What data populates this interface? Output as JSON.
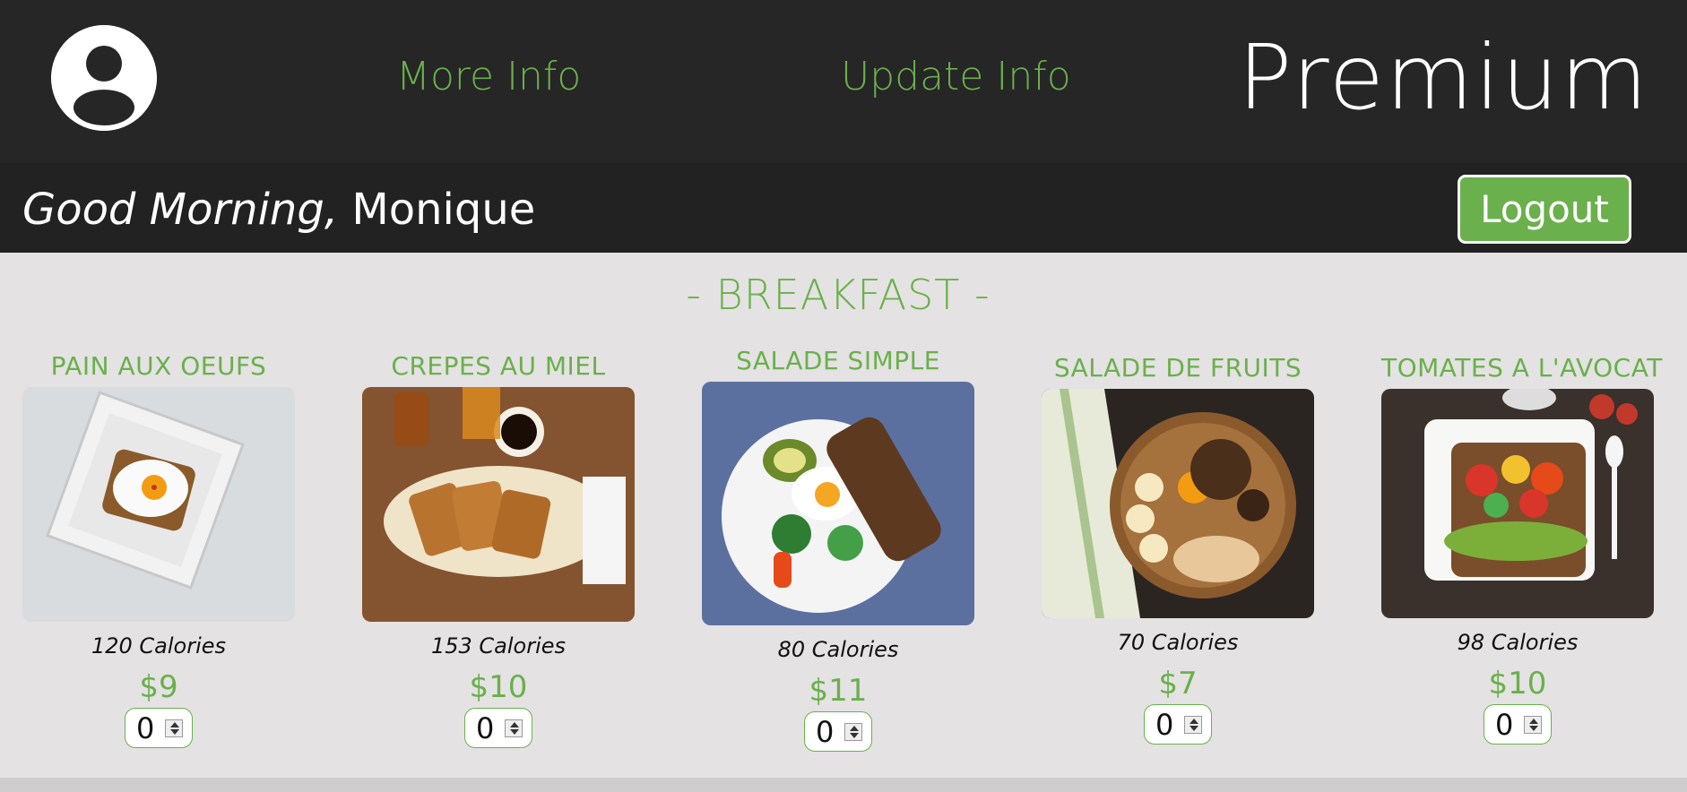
{
  "header": {
    "nav": {
      "more_info": "More Info",
      "update_info": "Update Info"
    },
    "brand": "Premium",
    "avatar_icon": "user-circle-icon"
  },
  "greeting": {
    "hello": "Good Morning,",
    "name": "Monique"
  },
  "logout_label": "Logout",
  "section": {
    "title": "- BREAKFAST -"
  },
  "menu_items": [
    {
      "name": "PAIN AUX OEUFS",
      "calories": "120 Calories",
      "price": "$9",
      "quantity": "0"
    },
    {
      "name": "CREPES AU MIEL",
      "calories": "153 Calories",
      "price": "$10",
      "quantity": "0"
    },
    {
      "name": "SALADE SIMPLE",
      "calories": "80 Calories",
      "price": "$11",
      "quantity": "0"
    },
    {
      "name": "SALADE DE FRUITS",
      "calories": "70 Calories",
      "price": "$7",
      "quantity": "0"
    },
    {
      "name": "TOMATES A L'AVOCAT",
      "calories": "98 Calories",
      "price": "$10",
      "quantity": "0"
    }
  ],
  "colors": {
    "accent": "#6ab04c",
    "header_bg": "#262626",
    "content_bg": "#e4e2e2"
  }
}
